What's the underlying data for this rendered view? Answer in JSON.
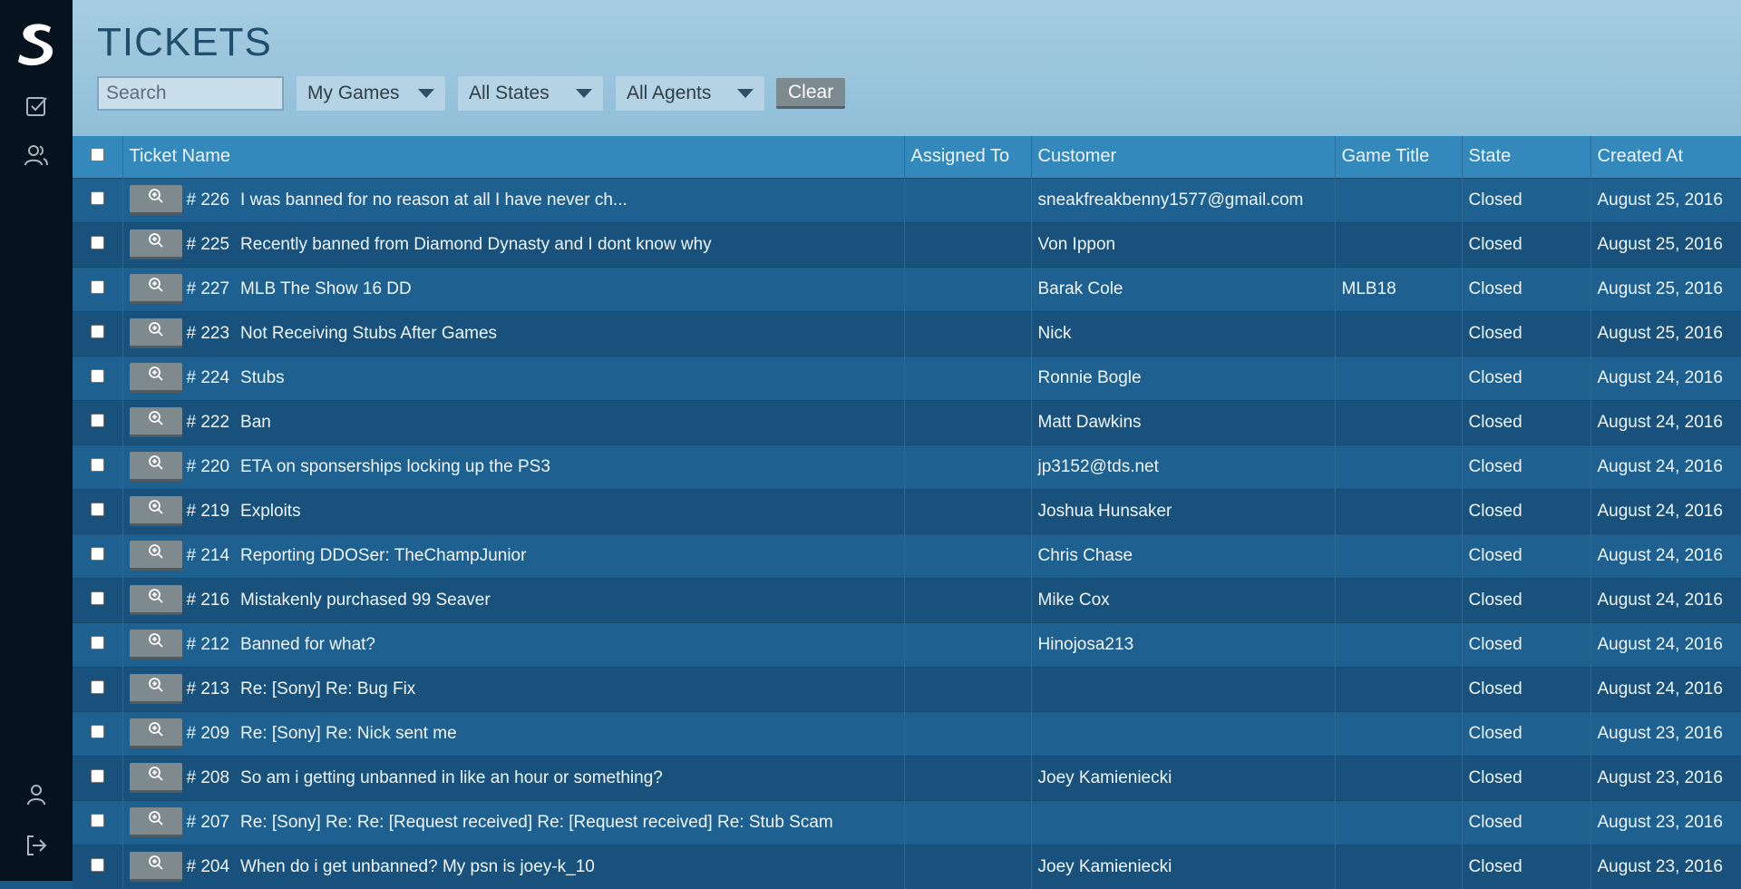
{
  "header": {
    "title": "TICKETS"
  },
  "filters": {
    "search_placeholder": "Search",
    "games": "My Games",
    "states": "All States",
    "agents": "All Agents",
    "clear": "Clear"
  },
  "columns": {
    "ticket_name": "Ticket Name",
    "assigned_to": "Assigned To",
    "customer": "Customer",
    "game_title": "Game Title",
    "state": "State",
    "created_at": "Created At"
  },
  "tickets": [
    {
      "number": "# 226",
      "name": "I was banned for no reason at all I have never ch...",
      "assigned": "",
      "customer": "sneakfreakbenny1577@gmail.com",
      "game": "",
      "state": "Closed",
      "created": "August 25, 2016"
    },
    {
      "number": "# 225",
      "name": "Recently banned from Diamond Dynasty and I dont know why",
      "assigned": "",
      "customer": "Von Ippon",
      "game": "",
      "state": "Closed",
      "created": "August 25, 2016"
    },
    {
      "number": "# 227",
      "name": "MLB The Show 16 DD",
      "assigned": "",
      "customer": "Barak Cole",
      "game": "MLB18",
      "state": "Closed",
      "created": "August 25, 2016"
    },
    {
      "number": "# 223",
      "name": "Not Receiving Stubs After Games",
      "assigned": "",
      "customer": "Nick",
      "game": "",
      "state": "Closed",
      "created": "August 25, 2016"
    },
    {
      "number": "# 224",
      "name": "Stubs",
      "assigned": "",
      "customer": "Ronnie Bogle",
      "game": "",
      "state": "Closed",
      "created": "August 24, 2016"
    },
    {
      "number": "# 222",
      "name": "Ban",
      "assigned": "",
      "customer": "Matt Dawkins",
      "game": "",
      "state": "Closed",
      "created": "August 24, 2016"
    },
    {
      "number": "# 220",
      "name": "ETA on sponserships locking up the PS3",
      "assigned": "",
      "customer": "jp3152@tds.net",
      "game": "",
      "state": "Closed",
      "created": "August 24, 2016"
    },
    {
      "number": "# 219",
      "name": "Exploits",
      "assigned": "",
      "customer": "Joshua Hunsaker",
      "game": "",
      "state": "Closed",
      "created": "August 24, 2016"
    },
    {
      "number": "# 214",
      "name": "Reporting DDOSer: TheChampJunior",
      "assigned": "",
      "customer": "Chris Chase",
      "game": "",
      "state": "Closed",
      "created": "August 24, 2016"
    },
    {
      "number": "# 216",
      "name": "Mistakenly purchased 99 Seaver",
      "assigned": "",
      "customer": "Mike Cox",
      "game": "",
      "state": "Closed",
      "created": "August 24, 2016"
    },
    {
      "number": "# 212",
      "name": "Banned for what?",
      "assigned": "",
      "customer": "Hinojosa213",
      "game": "",
      "state": "Closed",
      "created": "August 24, 2016"
    },
    {
      "number": "# 213",
      "name": "Re: [Sony] Re: Bug Fix",
      "assigned": "",
      "customer": "",
      "game": "",
      "state": "Closed",
      "created": "August 24, 2016"
    },
    {
      "number": "# 209",
      "name": "Re: [Sony] Re: Nick sent me",
      "assigned": "",
      "customer": "",
      "game": "",
      "state": "Closed",
      "created": "August 23, 2016"
    },
    {
      "number": "# 208",
      "name": "So am i getting unbanned in like an hour or something?",
      "assigned": "",
      "customer": "Joey Kamieniecki",
      "game": "",
      "state": "Closed",
      "created": "August 23, 2016"
    },
    {
      "number": "# 207",
      "name": "Re: [Sony] Re: Re: [Request received] Re: [Request received] Re: Stub Scam",
      "assigned": "",
      "customer": "",
      "game": "",
      "state": "Closed",
      "created": "August 23, 2016"
    },
    {
      "number": "# 204",
      "name": "When do i get unbanned? My psn is joey-k_10",
      "assigned": "",
      "customer": "Joey Kamieniecki",
      "game": "",
      "state": "Closed",
      "created": "August 23, 2016"
    }
  ]
}
